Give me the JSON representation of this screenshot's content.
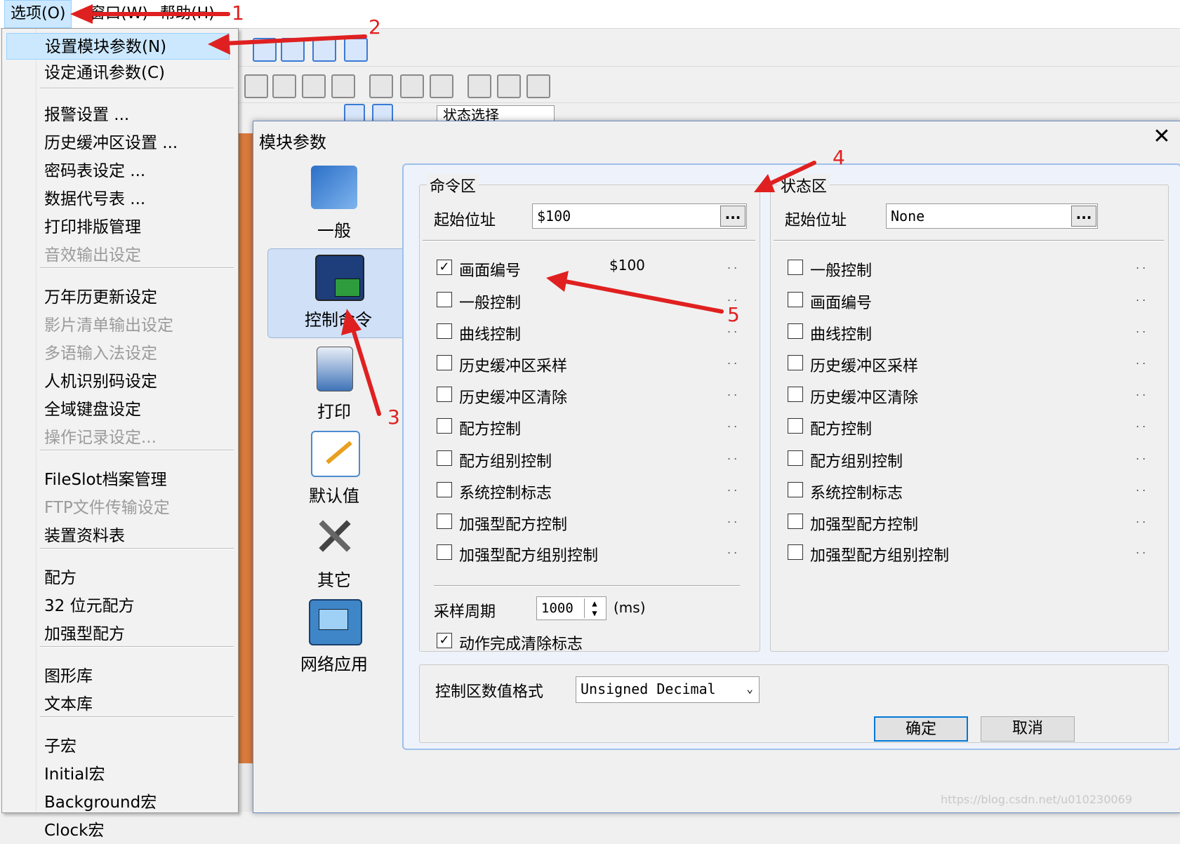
{
  "menubar": {
    "items": [
      "选项(O)",
      "窗口(W)",
      "帮助(H)"
    ]
  },
  "background": {
    "state_select": "状态选择"
  },
  "menu": {
    "items": [
      {
        "label": "设置模块参数(N)",
        "disabled": false,
        "selected": true
      },
      {
        "label": "设定通讯参数(C)",
        "disabled": false
      },
      {
        "label": "报警设置 ...",
        "disabled": false
      },
      {
        "label": "历史缓冲区设置 ...",
        "disabled": false
      },
      {
        "label": "密码表设定 ...",
        "disabled": false
      },
      {
        "label": "数据代号表 ...",
        "disabled": false
      },
      {
        "label": "打印排版管理",
        "disabled": false
      },
      {
        "label": "音效输出设定",
        "disabled": true
      },
      {
        "label": "万年历更新设定",
        "disabled": false
      },
      {
        "label": "影片清单输出设定",
        "disabled": true
      },
      {
        "label": "多语输入法设定",
        "disabled": true
      },
      {
        "label": "人机识别码设定",
        "disabled": false
      },
      {
        "label": "全域键盘设定",
        "disabled": false
      },
      {
        "label": "操作记录设定...",
        "disabled": true
      },
      {
        "label": "FileSlot档案管理",
        "disabled": false
      },
      {
        "label": "FTP文件传输设定",
        "disabled": true
      },
      {
        "label": "装置资料表",
        "disabled": false
      },
      {
        "label": "配方",
        "disabled": false
      },
      {
        "label": "32 位元配方",
        "disabled": false
      },
      {
        "label": "加强型配方",
        "disabled": false
      },
      {
        "label": "图形库",
        "disabled": false
      },
      {
        "label": "文本库",
        "disabled": false
      },
      {
        "label": "子宏",
        "disabled": false
      },
      {
        "label": "Initial宏",
        "disabled": false
      },
      {
        "label": "Background宏",
        "disabled": false
      },
      {
        "label": "Clock宏",
        "disabled": false
      }
    ]
  },
  "dialog": {
    "title": "模块参数",
    "close_icon": "close-icon",
    "nav": [
      {
        "label": "一般",
        "icon": "general-icon"
      },
      {
        "label": "控制命令",
        "icon": "control-command-icon"
      },
      {
        "label": "打印",
        "icon": "printer-icon"
      },
      {
        "label": "默认值",
        "icon": "default-value-icon"
      },
      {
        "label": "其它",
        "icon": "tools-icon"
      },
      {
        "label": "网络应用",
        "icon": "network-icon"
      }
    ],
    "command_area": {
      "title": "命令区",
      "start_label": "起始位址",
      "start_value": "$100",
      "browse": "...",
      "items": [
        {
          "label": "画面编号",
          "checked": true,
          "value": "$100"
        },
        {
          "label": "一般控制",
          "checked": false,
          "value": ""
        },
        {
          "label": "曲线控制",
          "checked": false,
          "value": ""
        },
        {
          "label": "历史缓冲区采样",
          "checked": false,
          "value": ""
        },
        {
          "label": "历史缓冲区清除",
          "checked": false,
          "value": ""
        },
        {
          "label": "配方控制",
          "checked": false,
          "value": ""
        },
        {
          "label": "配方组别控制",
          "checked": false,
          "value": ""
        },
        {
          "label": "系统控制标志",
          "checked": false,
          "value": ""
        },
        {
          "label": "加强型配方控制",
          "checked": false,
          "value": ""
        },
        {
          "label": "加强型配方组别控制",
          "checked": false,
          "value": ""
        }
      ],
      "sample_label": "采样周期",
      "sample_value": "1000",
      "sample_unit": "(ms)",
      "clear_flag_label": "动作完成清除标志",
      "clear_flag_checked": true
    },
    "status_area": {
      "title": "状态区",
      "start_label": "起始位址",
      "start_value": "None",
      "browse": "...",
      "items": [
        {
          "label": "一般控制",
          "checked": false
        },
        {
          "label": "画面编号",
          "checked": false
        },
        {
          "label": "曲线控制",
          "checked": false
        },
        {
          "label": "历史缓冲区采样",
          "checked": false
        },
        {
          "label": "历史缓冲区清除",
          "checked": false
        },
        {
          "label": "配方控制",
          "checked": false
        },
        {
          "label": "配方组别控制",
          "checked": false
        },
        {
          "label": "系统控制标志",
          "checked": false
        },
        {
          "label": "加强型配方控制",
          "checked": false
        },
        {
          "label": "加强型配方组别控制",
          "checked": false
        }
      ]
    },
    "format": {
      "label": "控制区数值格式",
      "value": "Unsigned Decimal"
    },
    "ok": "确定",
    "cancel": "取消"
  },
  "annotations": [
    "1",
    "2",
    "3",
    "4",
    "5"
  ],
  "watermark": "https://blog.csdn.net/u010230069",
  "colors": {
    "annotation": "#e02020",
    "selection": "#cce8ff",
    "panel_border": "#9ec0ea"
  }
}
